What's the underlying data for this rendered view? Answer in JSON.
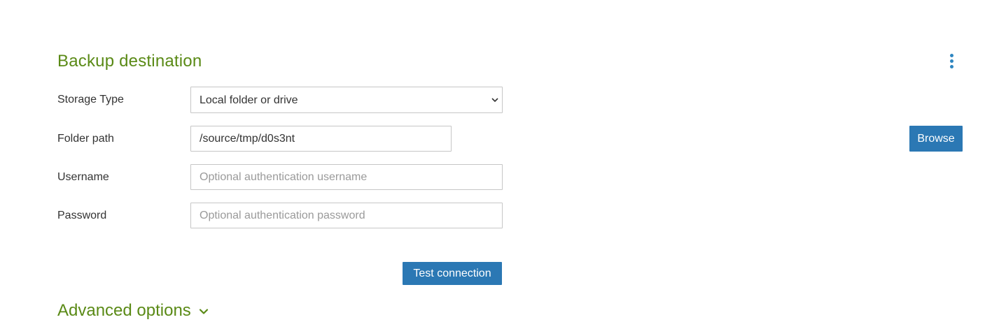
{
  "section": {
    "title": "Backup destination",
    "menu_icon": "more-vertical-icon"
  },
  "fields": {
    "storage_type": {
      "label": "Storage Type",
      "selected": "Local folder or drive",
      "options": [
        "Local folder or drive"
      ]
    },
    "folder_path": {
      "label": "Folder path",
      "value": "/source/tmp/d0s3nt",
      "browse_label": "Browse"
    },
    "username": {
      "label": "Username",
      "value": "",
      "placeholder": "Optional authentication username"
    },
    "password": {
      "label": "Password",
      "value": "",
      "placeholder": "Optional authentication password"
    }
  },
  "actions": {
    "test_connection_label": "Test connection"
  },
  "advanced": {
    "label": "Advanced options",
    "icon": "chevron-down-icon"
  },
  "colors": {
    "heading": "#5a8a16",
    "button": "#2b78b4",
    "menu_dots": "#2e86c1"
  }
}
